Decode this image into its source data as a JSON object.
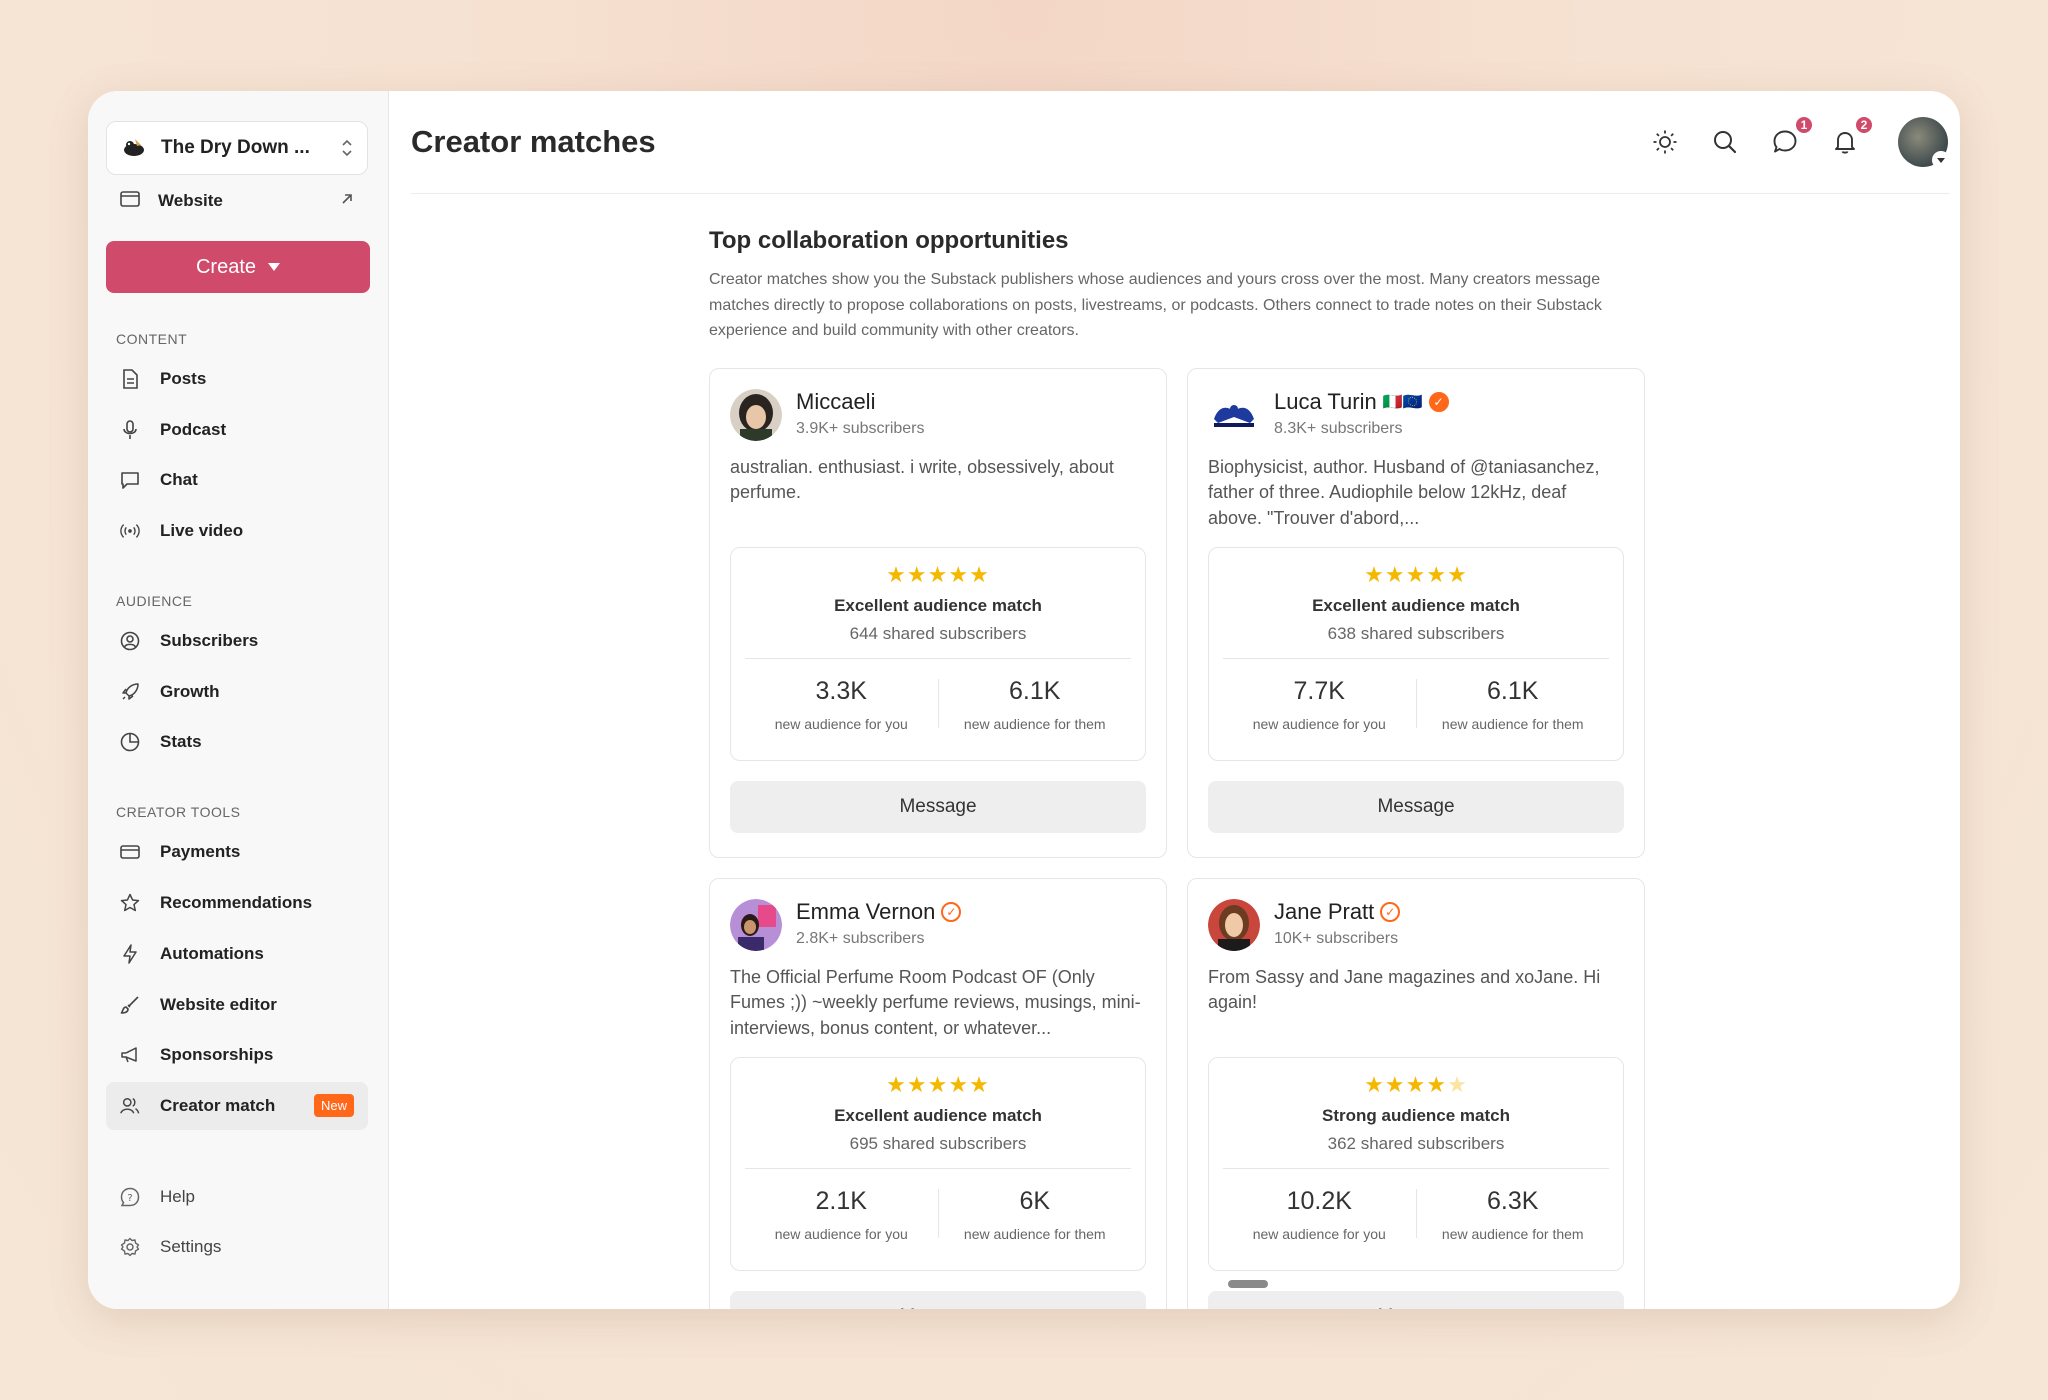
{
  "sidebar": {
    "publication": "The Dry Down ...",
    "website_label": "Website",
    "create_label": "Create",
    "sections": {
      "content": "CONTENT",
      "audience": "AUDIENCE",
      "creator_tools": "CREATOR TOOLS"
    },
    "content_items": [
      {
        "label": "Posts",
        "icon": "document-icon"
      },
      {
        "label": "Podcast",
        "icon": "microphone-icon"
      },
      {
        "label": "Chat",
        "icon": "chat-bubble-icon"
      },
      {
        "label": "Live video",
        "icon": "broadcast-icon"
      }
    ],
    "audience_items": [
      {
        "label": "Subscribers",
        "icon": "user-circle-icon"
      },
      {
        "label": "Growth",
        "icon": "rocket-icon"
      },
      {
        "label": "Stats",
        "icon": "pie-chart-icon"
      }
    ],
    "tool_items": [
      {
        "label": "Payments",
        "icon": "credit-card-icon"
      },
      {
        "label": "Recommendations",
        "icon": "star-icon"
      },
      {
        "label": "Automations",
        "icon": "lightning-icon"
      },
      {
        "label": "Website editor",
        "icon": "paintbrush-icon"
      },
      {
        "label": "Sponsorships",
        "icon": "megaphone-icon"
      },
      {
        "label": "Creator match",
        "icon": "users-icon",
        "badge": "New"
      }
    ],
    "footer_items": [
      {
        "label": "Help",
        "icon": "help-icon"
      },
      {
        "label": "Settings",
        "icon": "gear-icon"
      }
    ]
  },
  "header": {
    "title": "Creator matches",
    "chat_count": "1",
    "notif_count": "2"
  },
  "main": {
    "heading": "Top collaboration opportunities",
    "description": "Creator matches show you the Substack publishers whose audiences and yours cross over the most. Many creators message matches directly to propose collaborations on posts, livestreams, or podcasts. Others connect to trade notes on their Substack experience and build community with other creators.",
    "message_label": "Message",
    "new_for_you_label": "new audience for you",
    "new_for_them_label": "new audience for them",
    "cards": [
      {
        "name": "Miccaeli",
        "subscribers": "3.9K+ subscribers",
        "bio": "australian. enthusiast. i write, obsessively, about perfume.",
        "rating": 5,
        "match": "Excellent audience match",
        "shared": "644 shared subscribers",
        "for_you": "3.3K",
        "for_them": "6.1K",
        "verified": false,
        "flags": ""
      },
      {
        "name": "Luca Turin",
        "subscribers": "8.3K+ subscribers",
        "bio": "Biophysicist, author. Husband of @taniasanchez, father of three. Audiophile below 12kHz, deaf above. \"Trouver d'abord,...",
        "rating": 5,
        "match": "Excellent audience match",
        "shared": "638 shared subscribers",
        "for_you": "7.7K",
        "for_them": "6.1K",
        "verified": true,
        "flags": "🇮🇹🇪🇺"
      },
      {
        "name": "Emma Vernon",
        "subscribers": "2.8K+ subscribers",
        "bio": "The Official Perfume Room Podcast OF (Only Fumes ;)) ~weekly perfume reviews, musings, mini-interviews, bonus content, or whatever...",
        "rating": 5,
        "match": "Excellent audience match",
        "shared": "695 shared subscribers",
        "for_you": "2.1K",
        "for_them": "6K",
        "verified": true,
        "flags": ""
      },
      {
        "name": "Jane Pratt",
        "subscribers": "10K+ subscribers",
        "bio": "From Sassy and Jane magazines and xoJane. Hi again!",
        "rating": 4,
        "match": "Strong audience match",
        "shared": "362 shared subscribers",
        "for_you": "10.2K",
        "for_them": "6.3K",
        "verified": true,
        "flags": ""
      }
    ]
  },
  "colors": {
    "accent": "#d04b6b",
    "badge": "#ff6719",
    "star": "#f5b800"
  }
}
